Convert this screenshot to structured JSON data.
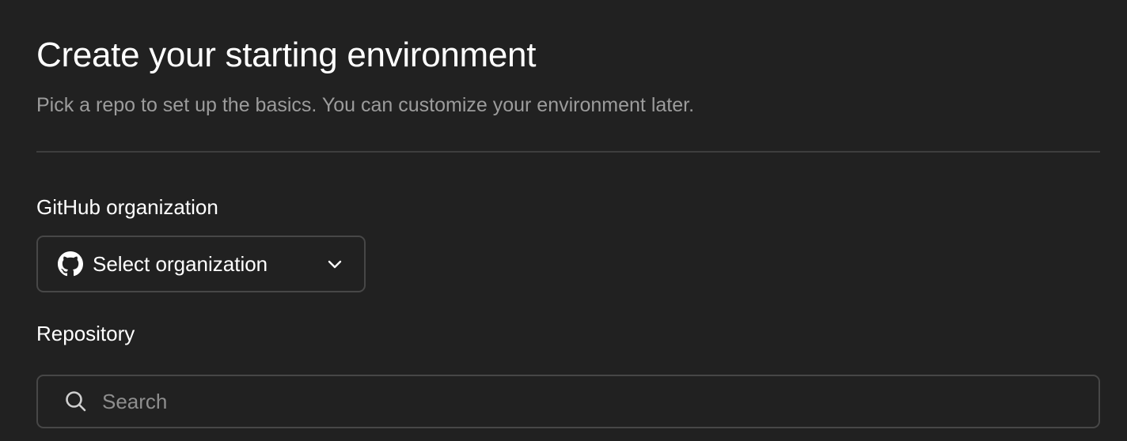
{
  "header": {
    "title": "Create your starting environment",
    "subtitle": "Pick a repo to set up the basics. You can customize your environment later."
  },
  "organization": {
    "label": "GitHub organization",
    "selected_value": "Select organization",
    "icon": "github-icon",
    "dropdown_icon": "chevron-down-icon"
  },
  "repository": {
    "label": "Repository",
    "search_placeholder": "Search",
    "search_value": "",
    "icon": "search-icon"
  },
  "colors": {
    "background": "#212121",
    "border": "#474747",
    "divider": "#3e3e3e",
    "text_primary": "#ffffff",
    "text_secondary": "#9c9c9c"
  }
}
